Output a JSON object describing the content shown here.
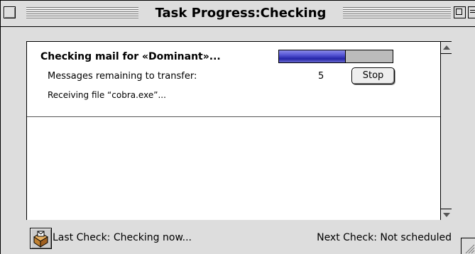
{
  "window": {
    "title": "Task Progress:Checking"
  },
  "task": {
    "heading": "Checking mail for «Dominant»...",
    "progress_fraction": 0.58,
    "remaining_label": "Messages remaining to transfer:",
    "remaining_count": "5",
    "stop_label": "Stop",
    "receiving_text": "Receiving file “cobra.exe”..."
  },
  "status": {
    "last_check": "Last Check: Checking now...",
    "next_check": "Next Check: Not scheduled"
  },
  "icons": {
    "status_icon": "mailbox-icon",
    "close": "close-box-icon",
    "zoom": "zoom-box-icon",
    "collapse": "collapse-box-icon",
    "scroll_up": "scroll-up-arrow-icon",
    "scroll_down": "scroll-down-arrow-icon",
    "grow": "resize-grip-icon"
  },
  "colors": {
    "progress_fill": "#3c3cc8",
    "chrome": "#dddddd"
  }
}
